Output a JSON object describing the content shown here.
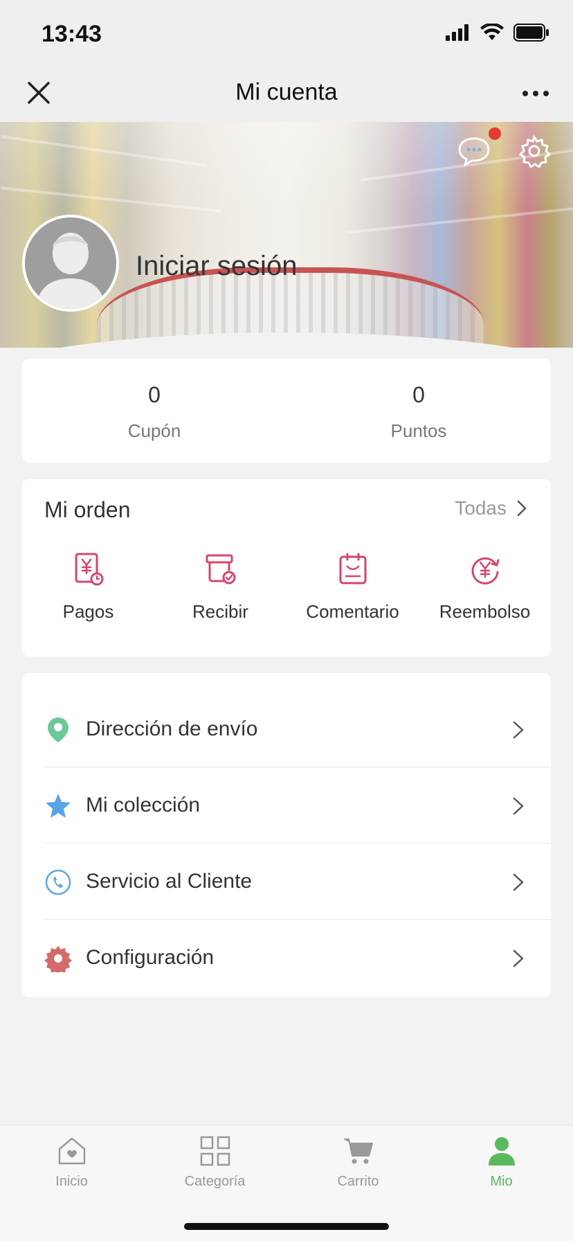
{
  "status_bar": {
    "time": "13:43",
    "icons": [
      "signal-icon",
      "wifi-icon",
      "battery-icon"
    ]
  },
  "nav": {
    "title": "Mi cuenta",
    "left_icon": "close-icon",
    "right_icon": "more-icon"
  },
  "profile": {
    "login_label": "Iniciar sesión",
    "notification_dot": true
  },
  "stats": [
    {
      "value": "0",
      "label": "Cupón"
    },
    {
      "value": "0",
      "label": "Puntos"
    }
  ],
  "orders": {
    "title": "Mi orden",
    "all_label": "Todas",
    "items": [
      {
        "label": "Pagos",
        "icon": "payment-icon"
      },
      {
        "label": "Recibir",
        "icon": "receive-icon"
      },
      {
        "label": "Comentario",
        "icon": "comment-icon"
      },
      {
        "label": "Reembolso",
        "icon": "refund-icon"
      }
    ]
  },
  "menu": [
    {
      "label": "Dirección de envío",
      "icon": "location-pin-icon"
    },
    {
      "label": "Mi colección",
      "icon": "star-icon"
    },
    {
      "label": "Servicio al Cliente",
      "icon": "phone-icon"
    },
    {
      "label": "Configuración",
      "icon": "gear-icon"
    }
  ],
  "tabs": [
    {
      "label": "Inicio",
      "icon": "home-icon",
      "active": false
    },
    {
      "label": "Categoría",
      "icon": "category-grid-icon",
      "active": false
    },
    {
      "label": "Carrito",
      "icon": "cart-icon",
      "active": false
    },
    {
      "label": "Mio",
      "icon": "user-icon",
      "active": true
    }
  ],
  "colors": {
    "accent_pink": "#d6456a",
    "active_green": "#5cb85c",
    "location_green": "#6cc79a",
    "star_blue": "#5aa4e6",
    "gear_red": "#d46a6a"
  }
}
